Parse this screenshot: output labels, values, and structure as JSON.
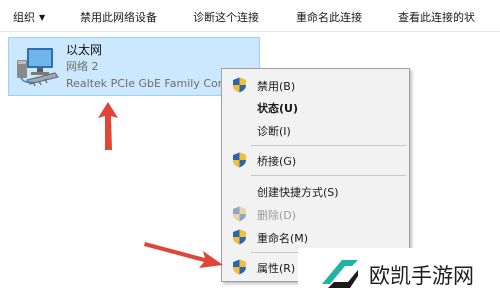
{
  "toolbar": {
    "organize": "组织",
    "disable_device": "禁用此网络设备",
    "diagnose": "诊断这个连接",
    "rename": "重命名此连接",
    "view_status": "查看此连接的状"
  },
  "adapter": {
    "name": "以太网",
    "network": "网络 2",
    "description": "Realtek PCIe GbE Family Controller",
    "icon": "network-adapter-icon"
  },
  "context_menu": {
    "items": [
      {
        "label": "禁用(B)",
        "icon": "shield-icon",
        "bold": false,
        "disabled": false
      },
      {
        "label": "状态(U)",
        "icon": "",
        "bold": true,
        "disabled": false
      },
      {
        "label": "诊断(I)",
        "icon": "",
        "bold": false,
        "disabled": false
      },
      {
        "label": "桥接(G)",
        "icon": "shield-icon",
        "bold": false,
        "disabled": false
      },
      {
        "label": "创建快捷方式(S)",
        "icon": "",
        "bold": false,
        "disabled": false
      },
      {
        "label": "删除(D)",
        "icon": "shield-icon",
        "bold": false,
        "disabled": true
      },
      {
        "label": "重命名(M)",
        "icon": "shield-icon",
        "bold": false,
        "disabled": false
      },
      {
        "label": "属性(R)",
        "icon": "shield-icon",
        "bold": false,
        "disabled": false
      }
    ]
  },
  "annotations": {
    "arrow_color": "#e0453a"
  },
  "watermark": {
    "text": "欧凯手游网",
    "logo_color": "#1fb3a5"
  }
}
